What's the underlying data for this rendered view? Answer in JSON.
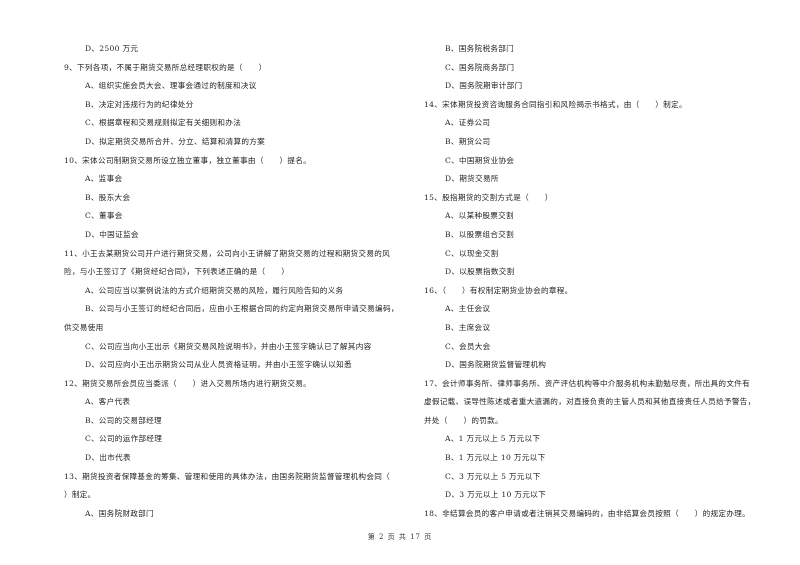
{
  "left_column": [
    {
      "type": "option",
      "text": "D、2500 万元"
    },
    {
      "type": "question",
      "text": "9、下列各项，不属于期货交易所总经理职权的是（　　）"
    },
    {
      "type": "option",
      "text": "A、组织实施会员大会、理事会通过的制度和决议"
    },
    {
      "type": "option",
      "text": "B、决定对违规行为的纪律处分"
    },
    {
      "type": "option",
      "text": "C、根据章程和交易规则拟定有关细则和办法"
    },
    {
      "type": "option",
      "text": "D、拟定期货交易所合并、分立、结算和清算的方案"
    },
    {
      "type": "question",
      "text": "10、宋体公司制期货交易所设立独立董事，独立董事由（　　）提名。"
    },
    {
      "type": "option",
      "text": "A、监事会"
    },
    {
      "type": "option",
      "text": "B、股东大会"
    },
    {
      "type": "option",
      "text": "C、董事会"
    },
    {
      "type": "option",
      "text": "D、中国证监会"
    },
    {
      "type": "question",
      "text": "11、小王去某期货公司开户进行期货交易，公司向小王讲解了期货交易的过程和期货交易的风"
    },
    {
      "type": "continuation",
      "text": "险，与小王签订了《期货经纪合同》，下列表述正确的是（　　）"
    },
    {
      "type": "option",
      "text": "A、公司应当以案例说法的方式介绍期货交易的风险，履行风险告知的义务"
    },
    {
      "type": "option",
      "text": "B、公司与小王签订的经纪合同后，应由小王根据合同的约定向期货交易所申请交易编码，"
    },
    {
      "type": "continuation",
      "text": "供交易使用"
    },
    {
      "type": "option",
      "text": "C、公司应当向小王出示《期货交易风险说明书》，并由小王签字确认已了解其内容"
    },
    {
      "type": "option",
      "text": "D、公司应向小王出示期货公司从业人员资格证明，并由小王签字确认以知悉"
    },
    {
      "type": "question",
      "text": "12、期货交易所会员应当委派（　　）进入交易所场内进行期货交易。"
    },
    {
      "type": "option",
      "text": "A、客户代表"
    },
    {
      "type": "option",
      "text": "B、公司的交易部经理"
    },
    {
      "type": "option",
      "text": "C、公司的运作部经理"
    },
    {
      "type": "option",
      "text": "D、出市代表"
    },
    {
      "type": "question",
      "text": "13、期货投资者保障基金的筹集、管理和使用的具体办法，由国务院期货监督管理机构会同（"
    },
    {
      "type": "continuation",
      "text": "）制定。"
    },
    {
      "type": "option",
      "text": "A、国务院财政部门"
    }
  ],
  "right_column": [
    {
      "type": "option",
      "text": "B、国务院税务部门"
    },
    {
      "type": "option",
      "text": "C、国务院商务部门"
    },
    {
      "type": "option",
      "text": "D、国务院期审计部门"
    },
    {
      "type": "question",
      "text": "14、宋体期货投资咨询服务合同指引和风险揭示书格式，由（　　）制定。"
    },
    {
      "type": "option",
      "text": "A、证券公司"
    },
    {
      "type": "option",
      "text": "B、期货公司"
    },
    {
      "type": "option",
      "text": "C、中国期货业协会"
    },
    {
      "type": "option",
      "text": "D、期货交易所"
    },
    {
      "type": "question",
      "text": "15、股指期货的交割方式是（　　）"
    },
    {
      "type": "option",
      "text": "A、以某种股票交割"
    },
    {
      "type": "option",
      "text": "B、以股票组合交割"
    },
    {
      "type": "option",
      "text": "C、以现金交割"
    },
    {
      "type": "option",
      "text": "D、以股票指数交割"
    },
    {
      "type": "question",
      "text": "16、（　　）有权制定期货业协会的章程。"
    },
    {
      "type": "option",
      "text": "A、主任会议"
    },
    {
      "type": "option",
      "text": "B、主席会议"
    },
    {
      "type": "option",
      "text": "C、会员大会"
    },
    {
      "type": "option",
      "text": "D、国务院期货监督管理机构"
    },
    {
      "type": "question",
      "text": "17、会计师事务所、律师事务所、资产评估机构等中介服务机构未勤勉尽责，所出具的文件有"
    },
    {
      "type": "continuation",
      "text": "虚假记载、误导性陈述或者重大遗漏的，对直接负责的主管人员和其他直接责任人员给予警告，"
    },
    {
      "type": "continuation",
      "text": "并处（　　）的罚款。"
    },
    {
      "type": "option",
      "text": "A、1 万元以上 5 万元以下"
    },
    {
      "type": "option",
      "text": "B、1 万元以上 10 万元以下"
    },
    {
      "type": "option",
      "text": "C、3 万元以上 5 万元以下"
    },
    {
      "type": "option",
      "text": "D、3 万元以上 10 万元以下"
    },
    {
      "type": "question",
      "text": "18、非结算会员的客户申请或者注销其交易编码的，由非结算会员按照（　　）的规定办理。"
    }
  ],
  "footer": {
    "page_label": "第 2 页 共 17 页"
  }
}
